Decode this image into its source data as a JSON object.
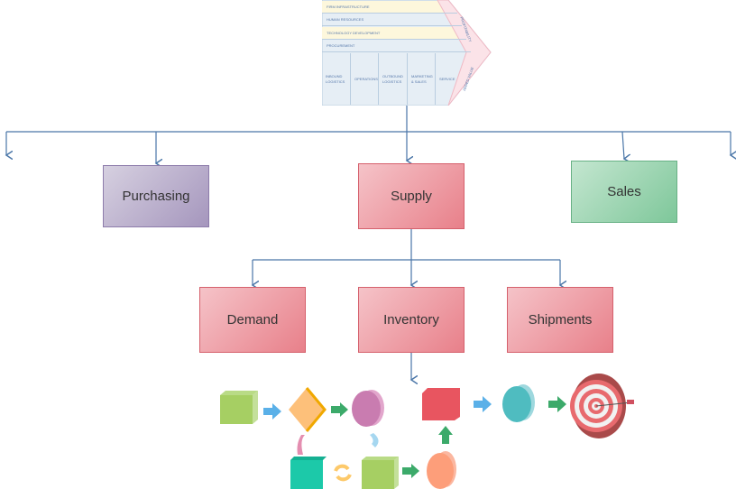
{
  "value_chain": {
    "support": [
      "FIRM INFRASTRUCTURE",
      "HUMAN RESOURCES",
      "TECHNOLOGY DEVELOPMENT",
      "PROCUREMENT"
    ],
    "primary": [
      "INBOUND LOGISTICS",
      "OPERATIONS",
      "OUTBOUND LOGISTICS",
      "MARKETING & SALES",
      "SERVICE"
    ],
    "margin_top": "PROFITABILITY",
    "margin_bottom": "ADDED VALUE"
  },
  "nodes": {
    "purchasing": "Purchasing",
    "supply": "Supply",
    "sales": "Sales",
    "demand": "Demand",
    "inventory": "Inventory",
    "shipments": "Shipments"
  },
  "colors": {
    "connector": "#4a76a8",
    "red": "#e8808a",
    "purple": "#a596bd",
    "green": "#7ec79a"
  }
}
